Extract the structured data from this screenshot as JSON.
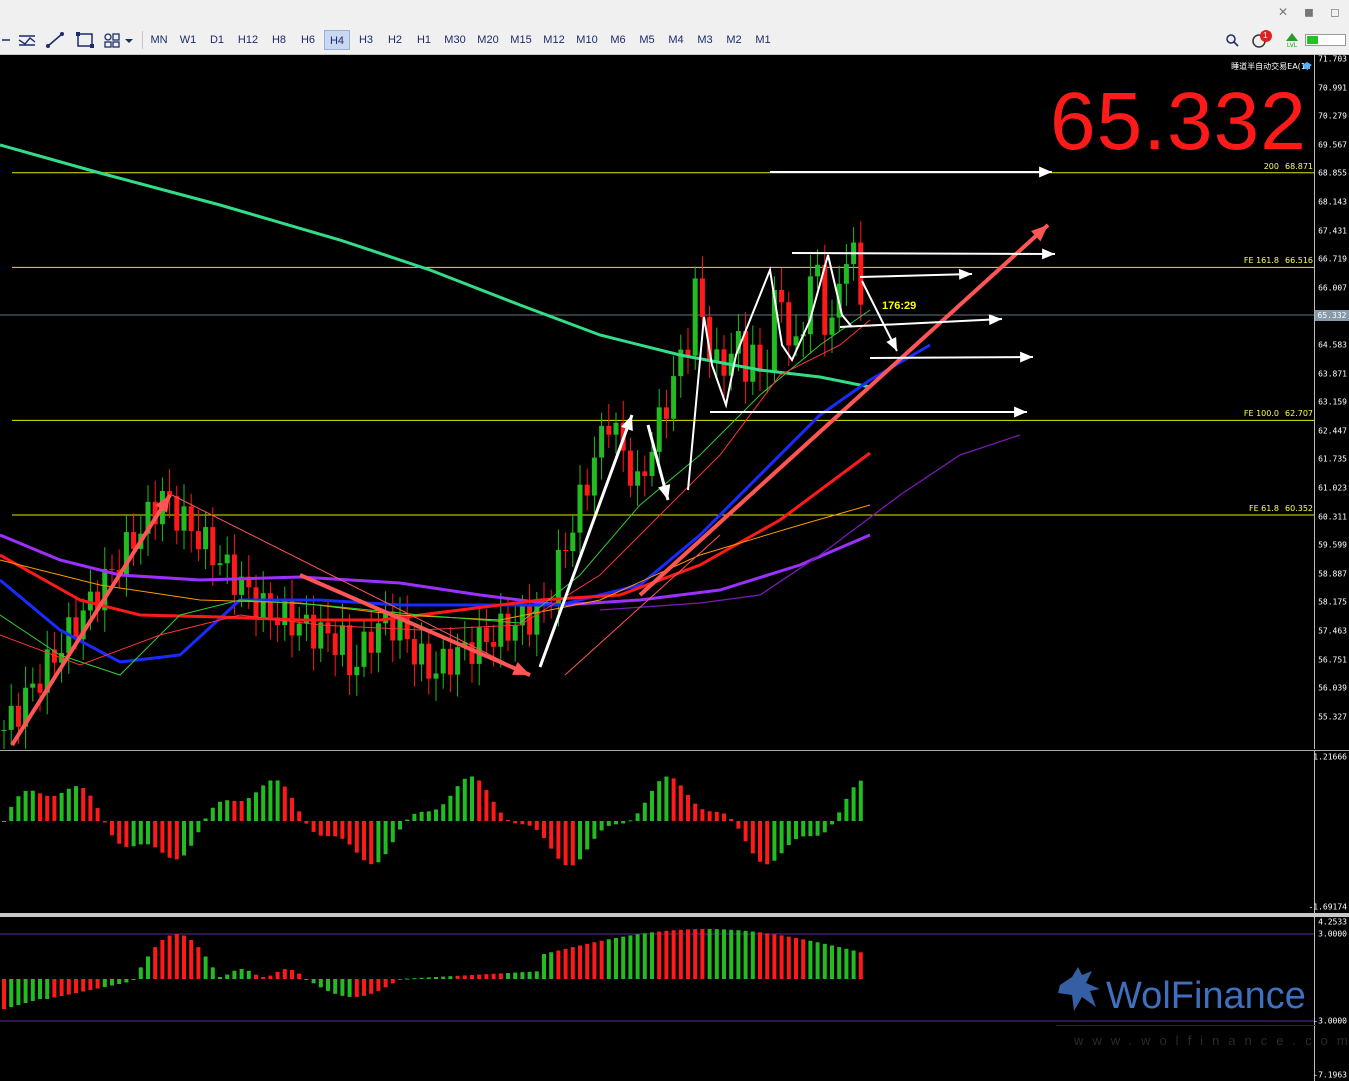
{
  "toolbar": {
    "tools": [
      "crosshair-icon",
      "indicators-icon",
      "trendline-icon",
      "rectangle-icon",
      "shapes-icon"
    ],
    "timeframes": [
      "MN",
      "W1",
      "D1",
      "H12",
      "H8",
      "H6",
      "H4",
      "H3",
      "H2",
      "H1",
      "M30",
      "M20",
      "M15",
      "M12",
      "M10",
      "M6",
      "M5",
      "M4",
      "M3",
      "M2",
      "M1"
    ],
    "active_timeframe": "H4",
    "notification_count": "1",
    "lvl_label": "LVL"
  },
  "chart": {
    "ea_label": "睡道半自动交易EA(1)",
    "big_price": "65.332",
    "current_price_tag": "65.332",
    "timer": "176:29",
    "levels": [
      {
        "label": "200",
        "value": "68.871",
        "price": 68.871
      },
      {
        "label": "FE 161.8",
        "value": "66.516",
        "price": 66.516
      },
      {
        "label": "FE 100.0",
        "value": "62.707",
        "price": 62.707
      },
      {
        "label": "FE 61.8",
        "value": "60.352",
        "price": 60.352
      }
    ],
    "price_axis": [
      "71.703",
      "70.991",
      "70.279",
      "69.567",
      "68.855",
      "68.143",
      "67.431",
      "66.719",
      "66.007",
      "64.583",
      "63.871",
      "63.159",
      "62.447",
      "61.735",
      "61.023",
      "60.311",
      "59.599",
      "58.887",
      "58.175",
      "57.463",
      "56.751",
      "56.039",
      "55.327"
    ],
    "osc1_axis": [
      "1.21666",
      "-1.69174"
    ],
    "osc2_axis": [
      "4.2533",
      "3.0000",
      "-3.0000",
      "-7.1963"
    ]
  },
  "watermark": {
    "brand": "WolFinance",
    "url": "www.wolfinance.com"
  },
  "colors": {
    "bull": "#22bb22",
    "bear": "#ff1a1a",
    "ma200": "#33dd88",
    "ma_blue": "#1a2bff",
    "ma_red": "#ff1a1a",
    "ma_purple": "#9b30ff",
    "level_line": "#e6e600"
  }
}
